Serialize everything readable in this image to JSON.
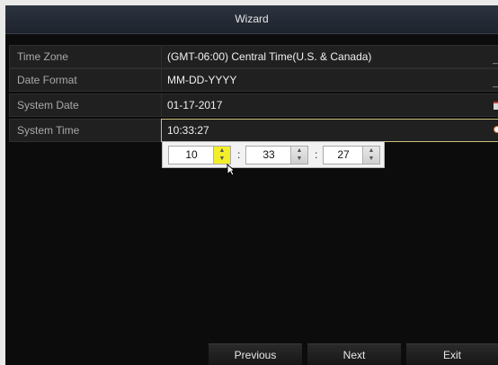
{
  "window": {
    "title": "Wizard"
  },
  "rows": [
    {
      "label": "Time Zone",
      "value": "(GMT-06:00) Central Time(U.S. & Canada)",
      "icon": "dropdown-arrow"
    },
    {
      "label": "Date Format",
      "value": "MM-DD-YYYY",
      "icon": "dropdown-arrow"
    },
    {
      "label": "System Date",
      "value": "01-17-2017",
      "icon": "calendar-icon"
    },
    {
      "label": "System Time",
      "value": "10:33:27",
      "icon": "clock-icon"
    }
  ],
  "time_picker": {
    "hour": "10",
    "minute": "33",
    "second": "27",
    "separator": ":",
    "highlight_color": "#f2ee2a"
  },
  "buttons": {
    "previous": "Previous",
    "next": "Next",
    "exit": "Exit"
  },
  "colors": {
    "background": "#0c0c0c",
    "titlebar": "#2c3340",
    "focus_border": "#c9c17a"
  }
}
